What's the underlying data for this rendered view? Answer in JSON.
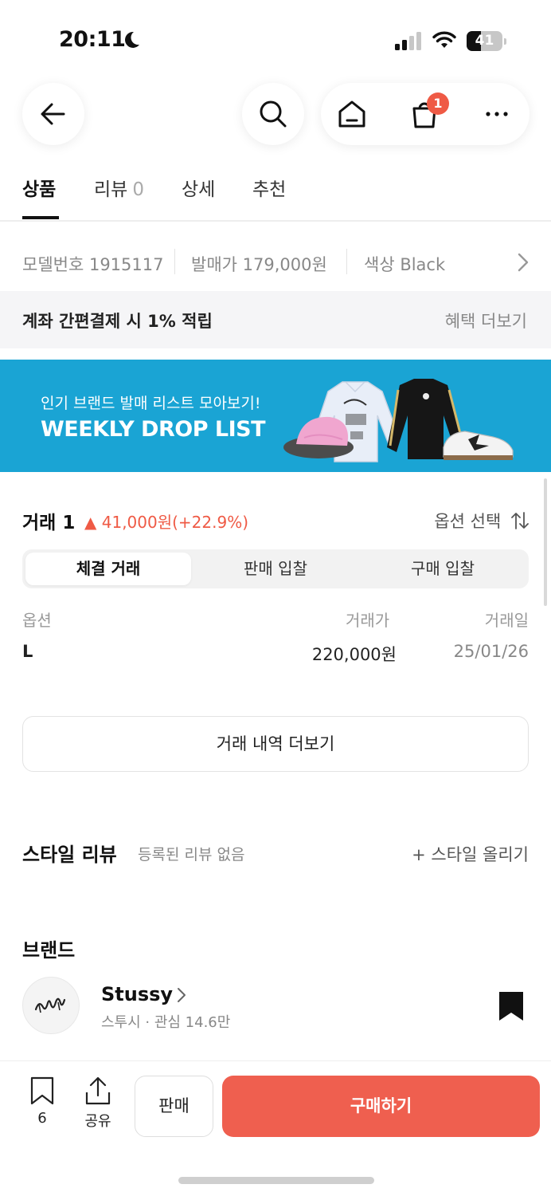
{
  "status_bar": {
    "time": "20:11",
    "battery_level": "41",
    "battery_fraction": 0.41
  },
  "header": {
    "cart_badge": "1"
  },
  "tabs": [
    {
      "label": "상품",
      "active": true
    },
    {
      "label": "리뷰",
      "count": "0"
    },
    {
      "label": "상세"
    },
    {
      "label": "추천"
    }
  ],
  "specs": {
    "model": "모델번호 1915117",
    "release_price": "발매가 179,000원",
    "color": "색상 Black"
  },
  "benefit": {
    "text": "계좌 간편결제 시 1% 적립",
    "more": "혜택 더보기"
  },
  "banner": {
    "subtitle": "인기 브랜드 발매 리스트 모아보기!",
    "title": "WEEKLY DROP LIST"
  },
  "trade": {
    "title": "거래 1",
    "delta": "▲ 41,000원(+22.9%)",
    "option_select": "옵션 선택",
    "segments": [
      "체결 거래",
      "판매 입찰",
      "구매 입찰"
    ],
    "columns": [
      "옵션",
      "거래가",
      "거래일"
    ],
    "rows": [
      {
        "option": "L",
        "price": "220,000원",
        "date": "25/01/26"
      }
    ],
    "more_button": "거래 내역 더보기"
  },
  "style_review": {
    "title": "스타일 리뷰",
    "empty": "등록된 리뷰 없음",
    "upload": "+ 스타일 올리기"
  },
  "brand": {
    "section_title": "브랜드",
    "name": "Stussy",
    "meta": "스투시 · 관심 14.6만"
  },
  "bottom_bar": {
    "bookmark_count": "6",
    "share_label": "공유",
    "sell_label": "판매",
    "buy_label": "구매하기"
  }
}
